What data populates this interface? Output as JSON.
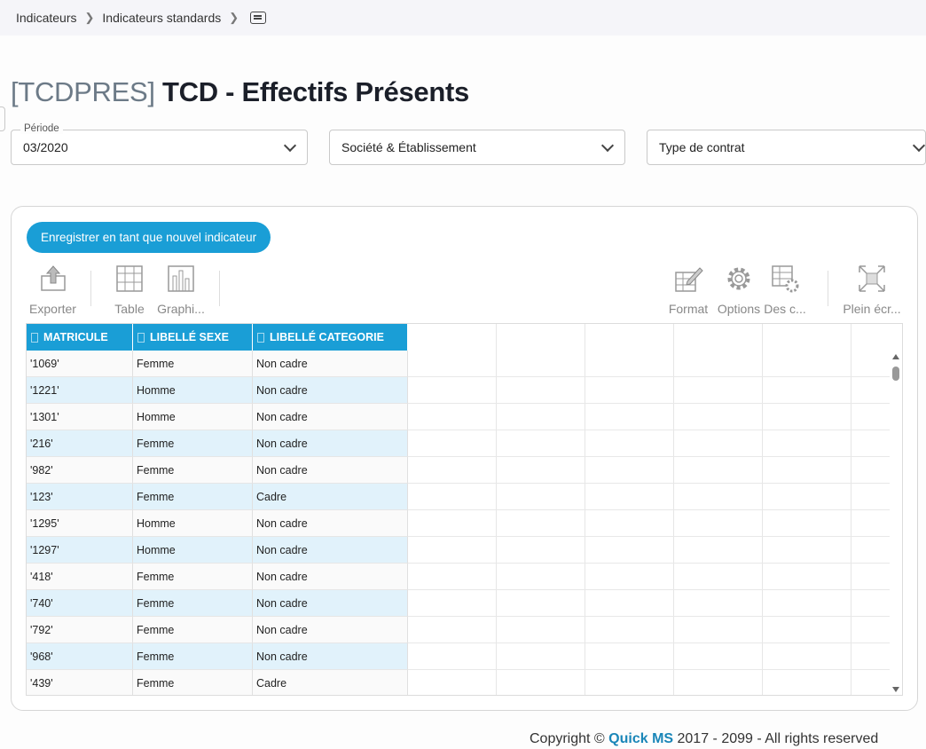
{
  "breadcrumb": {
    "items": [
      "Indicateurs",
      "Indicateurs standards"
    ]
  },
  "page": {
    "code": "[TCDPRES]",
    "title": "TCD - Effectifs Présents"
  },
  "filters": {
    "periode": {
      "label": "Période",
      "value": "03/2020"
    },
    "societe": {
      "value": "Société & Établissement"
    },
    "contrat": {
      "value": "Type de contrat"
    }
  },
  "panel": {
    "save_label": "Enregistrer en tant que nouvel indicateur",
    "toolbar": {
      "exporter": "Exporter",
      "table": "Table",
      "graphique": "Graphi...",
      "format": "Format",
      "options": "Options",
      "des": "Des c...",
      "plein_ecran": "Plein écr..."
    }
  },
  "grid": {
    "headers": [
      "MATRICULE",
      "LIBELLÉ SEXE",
      "LIBELLÉ CATEGORIE"
    ],
    "rows": [
      [
        "'1069'",
        "Femme",
        "Non cadre"
      ],
      [
        "'1221'",
        "Homme",
        "Non cadre"
      ],
      [
        "'1301'",
        "Homme",
        "Non cadre"
      ],
      [
        "'216'",
        "Femme",
        "Non cadre"
      ],
      [
        "'982'",
        "Femme",
        "Non cadre"
      ],
      [
        "'123'",
        "Femme",
        "Cadre"
      ],
      [
        "'1295'",
        "Homme",
        "Non cadre"
      ],
      [
        "'1297'",
        "Homme",
        "Non cadre"
      ],
      [
        "'418'",
        "Femme",
        "Non cadre"
      ],
      [
        "'740'",
        "Femme",
        "Non cadre"
      ],
      [
        "'792'",
        "Femme",
        "Non cadre"
      ],
      [
        "'968'",
        "Femme",
        "Non cadre"
      ],
      [
        "'439'",
        "Femme",
        "Cadre"
      ]
    ]
  },
  "footer": {
    "prefix": "Copyright © ",
    "brand": "Quick MS",
    "suffix": " 2017 - 2099 - All rights reserved"
  },
  "colors": {
    "accent": "#1a9ed6",
    "row_alt": "#e1f2fb"
  }
}
